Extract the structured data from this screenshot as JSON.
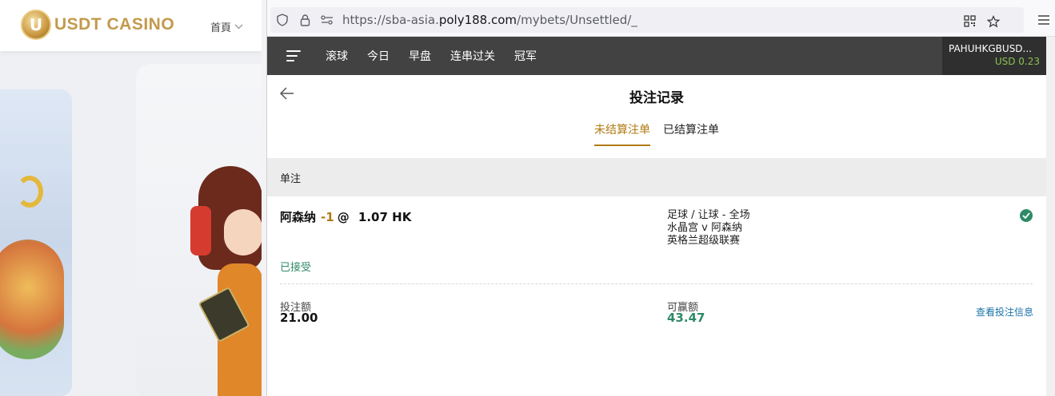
{
  "left_site": {
    "logo_text": "USDT CASINO",
    "logo_badge": "U",
    "nav_home": "首頁"
  },
  "browser": {
    "url_prefix": "https://sba-asia.",
    "url_domain": "poly188.com",
    "url_path": "/mybets/Unsettled/_"
  },
  "appbar": {
    "tabs": [
      "滚球",
      "今日",
      "早盘",
      "连串过关",
      "冠军"
    ],
    "account_name": "PAHUHKGBUSD...",
    "account_balance": "USD 0.23"
  },
  "page": {
    "title": "投注记录",
    "subtabs": [
      {
        "label": "未结算注单",
        "active": true
      },
      {
        "label": "已结算注单",
        "active": false
      }
    ],
    "section_header": "单注"
  },
  "bet": {
    "selection": "阿森纳",
    "handicap": "-1",
    "at": "@",
    "odds": "1.07 HK",
    "market": "足球 / 让球 - 全场",
    "match": "水晶宫 v 阿森纳",
    "league": "英格兰超级联赛",
    "status": "已接受",
    "stake_label": "投注额",
    "stake_value": "21.00",
    "win_label": "可赢额",
    "win_value": "43.47",
    "view_link": "查看投注信息"
  },
  "colors": {
    "accent_gold": "#b07a12",
    "success_green": "#2e8a66",
    "appbar_bg": "#424242",
    "link_blue": "#1a73a8"
  }
}
